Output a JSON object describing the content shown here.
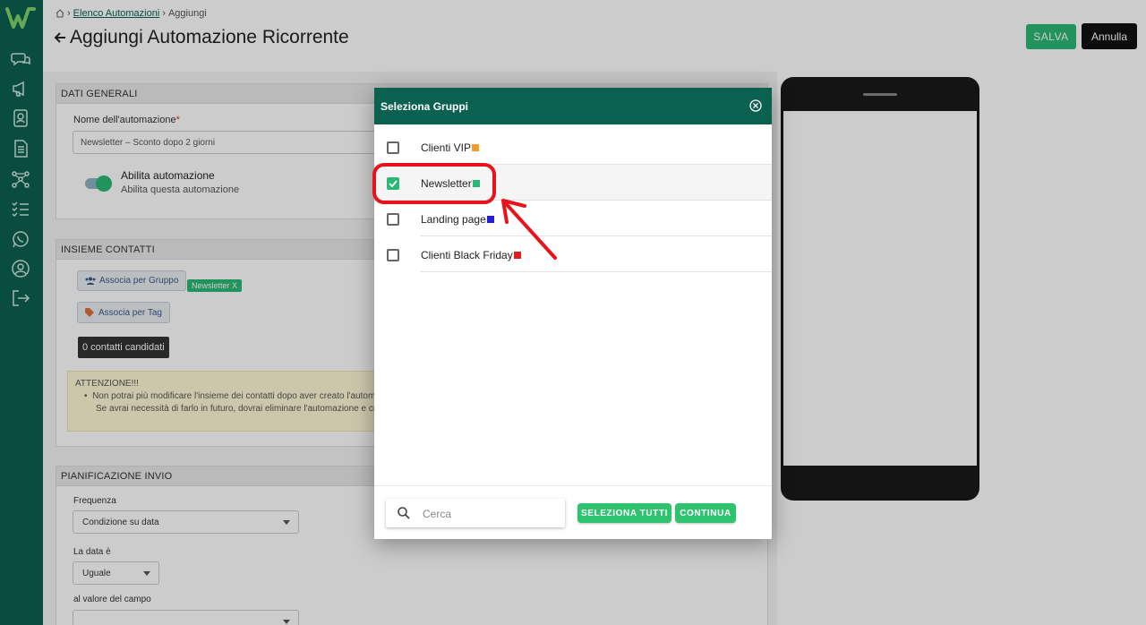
{
  "breadcrumb": {
    "home_icon": "home-icon",
    "link": "Elenco Automazioni",
    "current": "Aggiungi"
  },
  "header": {
    "title": "Aggiungi Automazione Ricorrente",
    "save": "SALVA",
    "cancel": "Annulla"
  },
  "general": {
    "section": "DATI GENERALI",
    "name_label": "Nome dell'automazione",
    "required_mark": "*",
    "name_value": "Newsletter – Sconto dopo 2 giorni",
    "toggle_title": "Abilita automazione",
    "toggle_desc": "Abilita questa automazione",
    "toggle_on": true
  },
  "contacts": {
    "section": "INSIEME CONTATTI",
    "group_btn": "Associa per Gruppo",
    "group_tag": "Newsletter X",
    "tag_btn": "Associa per Tag",
    "count": "0 contatti candidati",
    "warn_title": "ATTENZIONE!!!",
    "warn_line1": "Non potrai più modificare l'insieme dei contatti dopo aver creato l'automa",
    "warn_line2": "Se avrai necessità di farlo in futuro, dovrai eliminare l'automazione e crear"
  },
  "schedule": {
    "section": "PIANIFICAZIONE INVIO",
    "freq_label": "Frequenza",
    "freq_value": "Condizione su data",
    "date_label": "La data è",
    "date_value": "Uguale",
    "field_label": "al valore del campo"
  },
  "modal": {
    "title": "Seleziona Gruppi",
    "groups": [
      {
        "name": "Clienti VIP",
        "color": "#f39c2b",
        "checked": false
      },
      {
        "name": "Newsletter",
        "color": "#2bb873",
        "checked": true
      },
      {
        "name": "Landing page",
        "color": "#2020d8",
        "checked": false
      },
      {
        "name": "Clienti Black Friday",
        "color": "#e01e1e",
        "checked": false
      }
    ],
    "search_placeholder": "Cerca",
    "select_all": "SELEZIONA TUTTI",
    "continue": "CONTINUA"
  },
  "colors": {
    "brand": "#0b6150",
    "accent": "#2bb873",
    "annotation": "#e8141c"
  }
}
